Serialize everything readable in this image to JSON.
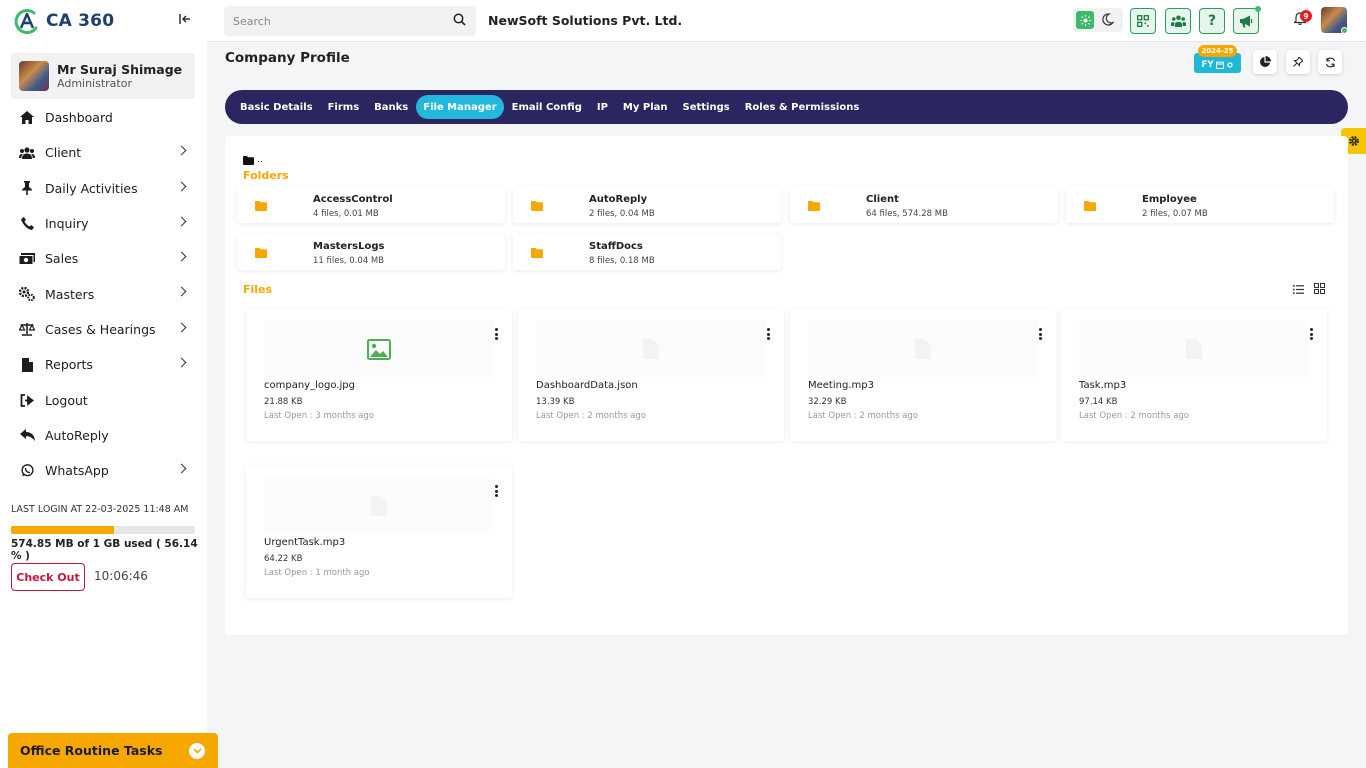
{
  "app": {
    "logo_text": "CA 360"
  },
  "user": {
    "name": "Mr Suraj Shimage",
    "role": "Administrator"
  },
  "sidebar": {
    "items": [
      {
        "label": "Dashboard",
        "icon": "home-icon",
        "has_children": false
      },
      {
        "label": "Client",
        "icon": "users-icon",
        "has_children": true
      },
      {
        "label": "Daily Activities",
        "icon": "pin-icon",
        "has_children": true
      },
      {
        "label": "Inquiry",
        "icon": "phone-icon",
        "has_children": true
      },
      {
        "label": "Sales",
        "icon": "cash-icon",
        "has_children": true
      },
      {
        "label": "Masters",
        "icon": "gears-icon",
        "has_children": true
      },
      {
        "label": "Cases & Hearings",
        "icon": "scale-icon",
        "has_children": true
      },
      {
        "label": "Reports",
        "icon": "file-icon",
        "has_children": true
      },
      {
        "label": "Logout",
        "icon": "logout-icon",
        "has_children": false
      },
      {
        "label": "AutoReply",
        "icon": "reply-icon",
        "has_children": false
      },
      {
        "label": "WhatsApp",
        "icon": "whatsapp-icon",
        "has_children": true
      }
    ],
    "last_login": "LAST LOGIN AT 22-03-2025 11:48 AM",
    "storage": {
      "text": "574.85 MB of 1 GB used ( 56.14 % )",
      "percent": 56.14
    },
    "checkout_label": "Check Out",
    "clock": "10:06:46",
    "routine_label": "Office Routine Tasks"
  },
  "topbar": {
    "search_placeholder": "Search",
    "company": "NewSoft Solutions Pvt. Ltd.",
    "help_label": "?",
    "notification_count": "9"
  },
  "page": {
    "title": "Company Profile",
    "fy_label": "FY",
    "fy_badge": "2024-25"
  },
  "tabs": [
    {
      "label": "Basic Details",
      "active": false
    },
    {
      "label": "Firms",
      "active": false
    },
    {
      "label": "Banks",
      "active": false
    },
    {
      "label": "File Manager",
      "active": true
    },
    {
      "label": "Email Config",
      "active": false
    },
    {
      "label": "IP",
      "active": false
    },
    {
      "label": "My Plan",
      "active": false
    },
    {
      "label": "Settings",
      "active": false
    },
    {
      "label": "Roles & Permissions",
      "active": false
    }
  ],
  "file_manager": {
    "root_label": "..",
    "folders_label": "Folders",
    "files_label": "Files",
    "folders": [
      {
        "name": "AccessControl",
        "meta": "4 files, 0.01 MB"
      },
      {
        "name": "AutoReply",
        "meta": "2 files, 0.04 MB"
      },
      {
        "name": "Client",
        "meta": "64 files, 574.28 MB"
      },
      {
        "name": "Employee",
        "meta": "2 files, 0.07 MB"
      },
      {
        "name": "MastersLogs",
        "meta": "11 files, 0.04 MB"
      },
      {
        "name": "StaffDocs",
        "meta": "8 files, 0.18 MB"
      }
    ],
    "files": [
      {
        "name": "company_logo.jpg",
        "size": "21.88 KB",
        "last_open": "Last Open : 3 months ago",
        "type": "image"
      },
      {
        "name": "DashboardData.json",
        "size": "13.39 KB",
        "last_open": "Last Open : 2 months ago",
        "type": "doc"
      },
      {
        "name": "Meeting.mp3",
        "size": "32.29 KB",
        "last_open": "Last Open : 2 months ago",
        "type": "doc"
      },
      {
        "name": "Task.mp3",
        "size": "97.14 KB",
        "last_open": "Last Open : 2 months ago",
        "type": "doc"
      },
      {
        "name": "UrgentTask.mp3",
        "size": "64.22 KB",
        "last_open": "Last Open : 1 month ago",
        "type": "doc"
      }
    ]
  },
  "colors": {
    "accent": "#f6a800",
    "tab_bar": "#2c2660",
    "tab_active": "#22b7dd",
    "brand_green": "#2d9d5b",
    "danger": "#c2183a"
  }
}
